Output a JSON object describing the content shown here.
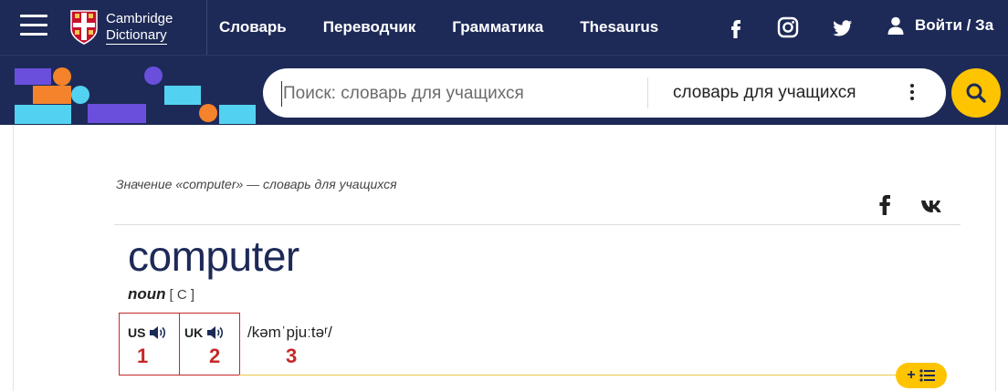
{
  "header": {
    "logo_line1": "Cambridge",
    "logo_line2": "Dictionary",
    "nav": [
      "Словарь",
      "Переводчик",
      "Грамматика",
      "Thesaurus"
    ],
    "social_icons": [
      "facebook-icon",
      "instagram-icon",
      "twitter-icon"
    ],
    "login_label": "Войти / За"
  },
  "search": {
    "placeholder": "Поиск: словарь для учащихся",
    "dictionary": "словарь для учащихся"
  },
  "entry": {
    "breadcrumb": "Значение «computer» — словарь для учащихся",
    "headword": "computer",
    "pos": "noun",
    "grammar": "[ C ]",
    "pron_us": "US",
    "pron_uk": "UK",
    "ipa": "/kəmˈpjuːtəʳ/",
    "annotations": [
      "1",
      "2",
      "3"
    ]
  },
  "colors": {
    "navy": "#1d2a57",
    "yellow": "#fec400",
    "annotation_red": "#c62828"
  }
}
